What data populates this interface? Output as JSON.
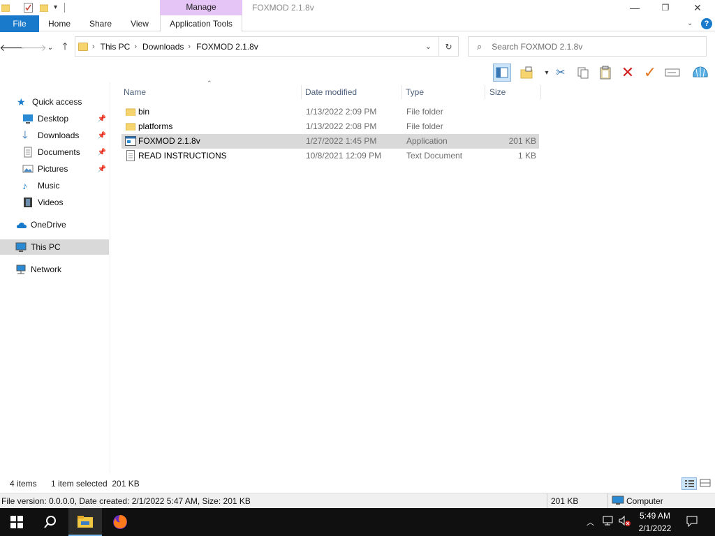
{
  "window": {
    "title": "FOXMOD 2.1.8v",
    "minimize": "—",
    "maximize": "❐",
    "close": "✕"
  },
  "ribbon": {
    "context_header": "Manage",
    "tabs": [
      "File",
      "Home",
      "Share",
      "View",
      "Application Tools"
    ]
  },
  "address": {
    "crumbs": [
      "This PC",
      "Downloads",
      "FOXMOD 2.1.8v"
    ]
  },
  "search": {
    "placeholder": "Search FOXMOD 2.1.8v"
  },
  "nav": {
    "items": [
      {
        "label": "Quick access",
        "icon": "star-icon"
      },
      {
        "label": "Desktop",
        "icon": "desktop-icon",
        "pinned": true
      },
      {
        "label": "Downloads",
        "icon": "download-arrow-icon",
        "pinned": true
      },
      {
        "label": "Documents",
        "icon": "documents-icon",
        "pinned": true
      },
      {
        "label": "Pictures",
        "icon": "pictures-icon",
        "pinned": true
      },
      {
        "label": "Music",
        "icon": "music-note-icon"
      },
      {
        "label": "Videos",
        "icon": "film-icon"
      },
      {
        "label": "OneDrive",
        "icon": "cloud-icon"
      },
      {
        "label": "This PC",
        "icon": "computer-icon",
        "selected": true
      },
      {
        "label": "Network",
        "icon": "network-icon"
      }
    ]
  },
  "columns": [
    "Name",
    "Date modified",
    "Type",
    "Size"
  ],
  "files": [
    {
      "name": "bin",
      "date": "1/13/2022 2:09 PM",
      "type": "File folder",
      "size": "",
      "icon": "folder-icon"
    },
    {
      "name": "platforms",
      "date": "1/13/2022 2:08 PM",
      "type": "File folder",
      "size": "",
      "icon": "folder-icon"
    },
    {
      "name": "FOXMOD 2.1.8v",
      "date": "1/27/2022 1:45 PM",
      "type": "Application",
      "size": "201 KB",
      "icon": "application-icon",
      "selected": true
    },
    {
      "name": "READ INSTRUCTIONS",
      "date": "10/8/2021 12:09 PM",
      "type": "Text Document",
      "size": "1 KB",
      "icon": "text-document-icon"
    }
  ],
  "status": {
    "item_count": "4 items",
    "selection": "1 item selected  201 KB",
    "file_info": "File version: 0.0.0.0, Date created: 2/1/2022 5:47 AM, Size: 201 KB",
    "size": "201 KB",
    "location": "Computer"
  },
  "taskbar": {
    "time": "5:49 AM",
    "date": "2/1/2022"
  },
  "colors": {
    "accent": "#1979ca",
    "context_tab": "#e4c5f5",
    "selection": "#d9d9d9",
    "taskbar": "#101010"
  }
}
